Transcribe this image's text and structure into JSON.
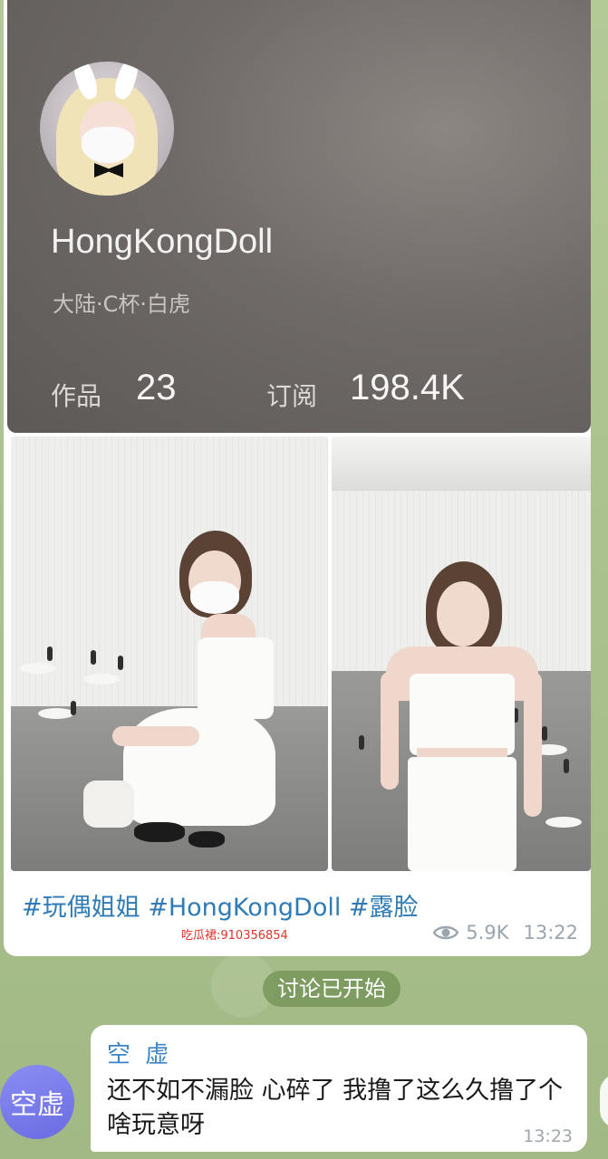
{
  "profile": {
    "username": "HongKongDoll",
    "tags": "大陆·C杯·白虎",
    "works_label": "作品",
    "works_value": "23",
    "subs_label": "订阅",
    "subs_value": "198.4K"
  },
  "post": {
    "hashtags": "#玩偶姐姐 #HongKongDoll #露脸",
    "watermark": "吃瓜裙:910356854",
    "views": "5.9K",
    "time": "13:22",
    "photos": [
      "photo-squatting",
      "photo-standing"
    ]
  },
  "service": {
    "text": "讨论已开始"
  },
  "reply": {
    "avatar_text": "空虚",
    "name": "空 虚",
    "text": "还不如不漏脸 心碎了 我撸了这么久撸了个啥玩意呀",
    "time": "13:23"
  },
  "colors": {
    "link": "#2f7bb5",
    "avatar": "#7a7cef",
    "watermark": "#e0332b",
    "chat_bg": "#a9c08e"
  }
}
